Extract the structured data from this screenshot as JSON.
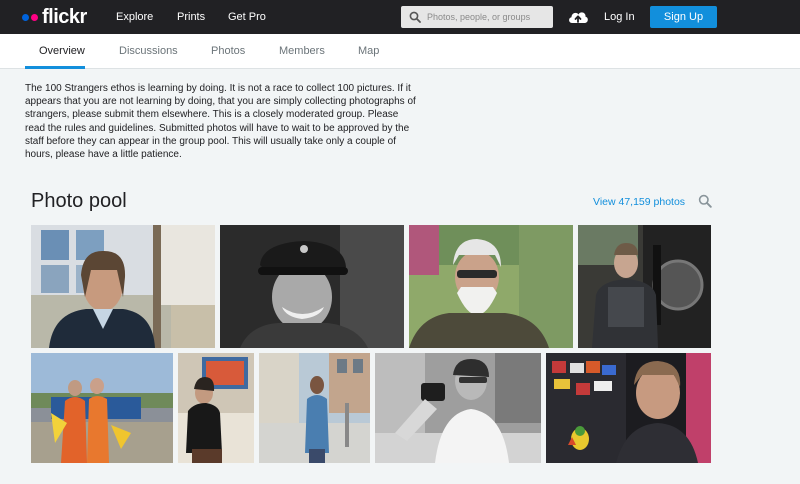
{
  "brand": {
    "name": "flickr",
    "dot_blue": "#0063dc",
    "dot_pink": "#ff0084"
  },
  "topnav": {
    "links": [
      "Explore",
      "Prints",
      "Get Pro"
    ],
    "search_placeholder": "Photos, people, or groups",
    "upload_icon": "cloud-upload-icon",
    "login": "Log In",
    "signup": "Sign Up",
    "accent": "#128fdc",
    "bar_color": "#212124"
  },
  "subnav": {
    "tabs": [
      "Overview",
      "Discussions",
      "Photos",
      "Members",
      "Map"
    ],
    "active_tab": "Overview"
  },
  "description": "The 100 Strangers ethos is learning by doing. It is not a race to collect 100 pictures. If it appears that you are not learning by doing, that you are simply collecting photographs of strangers, please submit them elsewhere. This is a closely moderated group. Please read the rules and guidelines. Submitted photos will have to wait to be approved by the staff before they can appear in the group pool. This will usually take only a couple of hours, please have a little patience.",
  "pool": {
    "title": "Photo pool",
    "view_link": "View 47,159 photos",
    "search_icon": "search-icon"
  }
}
